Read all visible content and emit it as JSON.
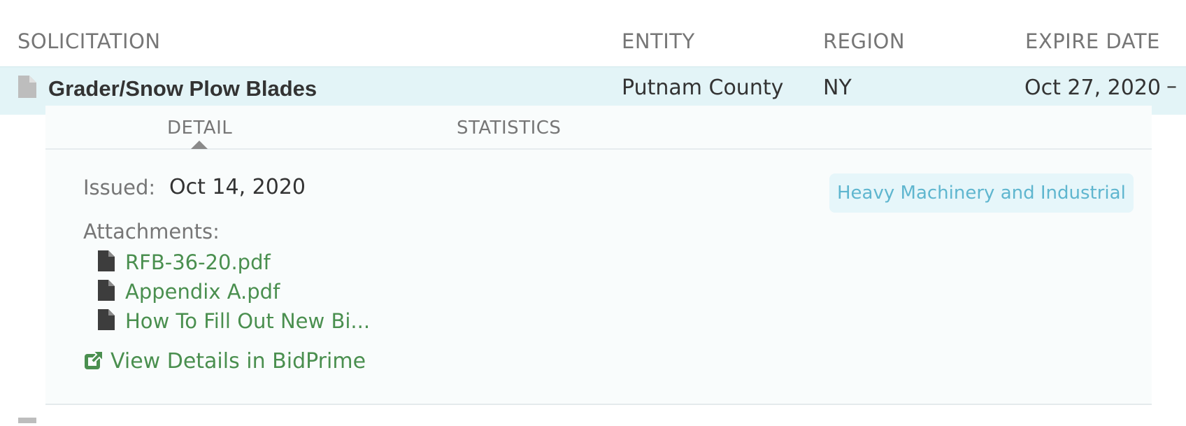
{
  "table": {
    "headers": {
      "solicitation": "SOLICITATION",
      "entity": "ENTITY",
      "region": "REGION",
      "expire_date": "EXPIRE DATE"
    },
    "selected_row": {
      "title": "Grader/Snow Plow Blades",
      "entity": "Putnam County",
      "region": "NY",
      "expire_date": "Oct 27, 2020",
      "collapse_symbol": "–"
    }
  },
  "detail": {
    "tabs": [
      {
        "label": "DETAIL",
        "active": true
      },
      {
        "label": "STATISTICS",
        "active": false
      }
    ],
    "issued_label": "Issued:",
    "issued_value": "Oct 14, 2020",
    "category_tag": "Heavy Machinery and Industrial",
    "attachments_label": "Attachments:",
    "attachments": [
      {
        "name": "RFB-36-20.pdf"
      },
      {
        "name": "Appendix A.pdf"
      },
      {
        "name": "How To Fill Out New Bi..."
      }
    ],
    "view_link": "View Details in BidPrime"
  },
  "icons": {
    "row_doc": "file-icon",
    "attachment": "file-icon",
    "external_link": "external-link-icon"
  },
  "colors": {
    "row_highlight": "#e3f4f7",
    "link_green": "#4a8f4f",
    "tag_blue": "#5fb6cf",
    "tag_bg": "#e6f6fa",
    "header_gray": "#767676"
  }
}
